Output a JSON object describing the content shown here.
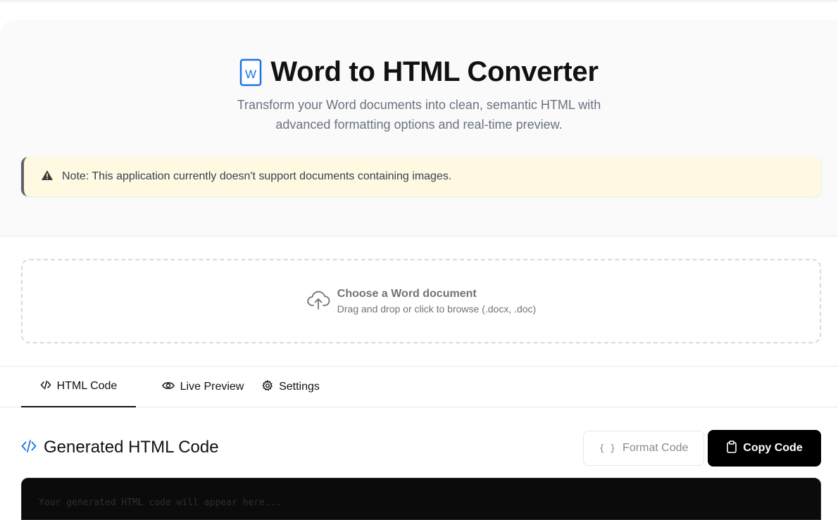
{
  "header": {
    "title": "Word to HTML Converter",
    "subtitle_line1": "Transform your Word documents into clean, semantic HTML with",
    "subtitle_line2": "advanced formatting options and real-time preview."
  },
  "note": {
    "text": "Note: This application currently doesn't support documents containing images.",
    "icon": "warning-icon"
  },
  "upload": {
    "title": "Choose a Word document",
    "subtitle": "Drag and drop or click to browse (.docx, .doc)",
    "icon": "cloud-upload-icon"
  },
  "tabs": [
    {
      "label": "HTML Code",
      "icon": "code-icon",
      "active": true
    },
    {
      "label": "Live Preview",
      "icon": "eye-icon",
      "active": false
    },
    {
      "label": "Settings",
      "icon": "gear-icon",
      "active": false
    }
  ],
  "code_section": {
    "title": "Generated HTML Code",
    "format_label": "Format Code",
    "copy_label": "Copy Code",
    "placeholder": "Your generated HTML code will appear here..."
  },
  "colors": {
    "accent": "#1a73e8",
    "note_bg": "#fef9e0",
    "copy_bg": "#000000"
  }
}
